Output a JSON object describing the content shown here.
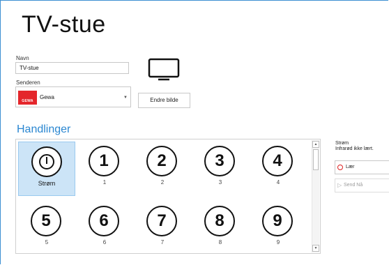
{
  "page": {
    "title": "TV-stue"
  },
  "form": {
    "name_label": "Navn",
    "name_value": "TV-stue",
    "sender_label": "Senderen",
    "sender_value": "Gewa",
    "sender_logo_text": "GEWA",
    "change_image_label": "Endre bilde",
    "image_icon": "tv-icon"
  },
  "actions": {
    "heading": "Handlinger",
    "items": [
      {
        "symbol": "power-icon",
        "label": "Strøm",
        "selected": true
      },
      {
        "symbol": "1",
        "label": "1"
      },
      {
        "symbol": "2",
        "label": "2"
      },
      {
        "symbol": "3",
        "label": "3"
      },
      {
        "symbol": "4",
        "label": "4"
      },
      {
        "symbol": "5",
        "label": "5"
      },
      {
        "symbol": "6",
        "label": "6"
      },
      {
        "symbol": "7",
        "label": "7"
      },
      {
        "symbol": "8",
        "label": "8"
      },
      {
        "symbol": "9",
        "label": "9"
      }
    ]
  },
  "details": {
    "title": "Strøm",
    "status": "Infrarød ikke lært.",
    "learn_label": "Lær",
    "send_label": "Send Nå"
  },
  "colors": {
    "accent": "#2b87d1",
    "selection": "#cce4f7",
    "logo": "#e4262b"
  }
}
